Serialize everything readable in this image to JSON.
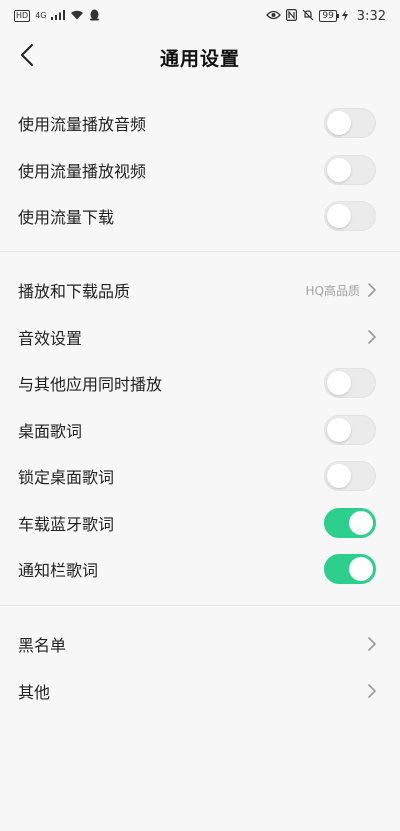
{
  "status_bar": {
    "hd": "HD",
    "network": "4G",
    "battery": "99",
    "time": "3:32",
    "icons": [
      "signal-icon",
      "wifi-icon",
      "qq-icon",
      "eye-icon",
      "nfc-icon",
      "mute-icon",
      "charging-icon"
    ]
  },
  "nav": {
    "title": "通用设置",
    "back_icon": "chevron-left-icon"
  },
  "group1": [
    {
      "label": "使用流量播放音频",
      "toggle": false
    },
    {
      "label": "使用流量播放视频",
      "toggle": false
    },
    {
      "label": "使用流量下载",
      "toggle": false
    }
  ],
  "group2": [
    {
      "label": "播放和下载品质",
      "value": "HQ高品质",
      "chevron": true
    },
    {
      "label": "音效设置",
      "chevron": true
    },
    {
      "label": "与其他应用同时播放",
      "toggle": false
    },
    {
      "label": "桌面歌词",
      "toggle": false
    },
    {
      "label": "锁定桌面歌词",
      "toggle": false
    },
    {
      "label": "车载蓝牙歌词",
      "toggle": true
    },
    {
      "label": "通知栏歌词",
      "toggle": true
    }
  ],
  "group3": [
    {
      "label": "黑名单",
      "chevron": true
    },
    {
      "label": "其他",
      "chevron": true
    }
  ],
  "colors": {
    "toggle_on": "#2ccf8c",
    "toggle_off": "#ebebeb",
    "background": "#f7f7f7"
  }
}
